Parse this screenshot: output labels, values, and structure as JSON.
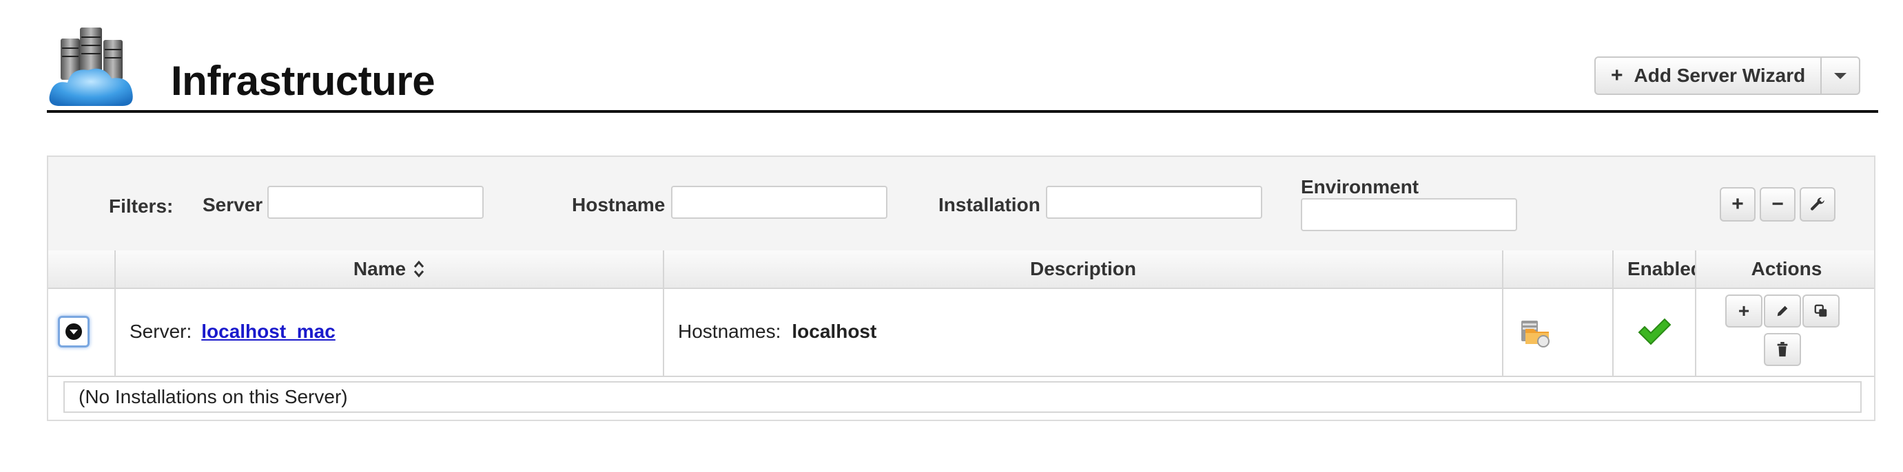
{
  "header": {
    "title": "Infrastructure",
    "logo_icon": "server-cloud-icon",
    "wizard_plus": "+",
    "wizard_label": "Add Server Wizard",
    "wizard_caret_icon": "caret-down-icon"
  },
  "filters": {
    "label": "Filters:",
    "server_label": "Server",
    "server_value": "",
    "hostname_label": "Hostname",
    "hostname_value": "",
    "installation_label": "Installation",
    "installation_value": "",
    "environment_label": "Environment",
    "environment_value": "",
    "add_symbol": "+",
    "remove_symbol": "−",
    "wrench_icon": "wrench-icon"
  },
  "table": {
    "columns": {
      "name": "Name",
      "description": "Description",
      "enabled": "Enabled",
      "actions": "Actions"
    },
    "sort_icon": "sort-icon",
    "rows": [
      {
        "name_prefix": "Server:",
        "name_link": "localhost_mac",
        "desc_prefix": "Hostnames:",
        "desc_value": "localhost",
        "type_icon": "server-folder-icon",
        "enabled_icon": "checkmark-icon",
        "action_add": "+",
        "action_edit_icon": "pencil-icon",
        "action_copy_icon": "copy-icon",
        "action_delete_icon": "trash-icon",
        "subrow_text": "(No Installations on this Server)"
      }
    ]
  },
  "colors": {
    "link": "#1a1acc",
    "check": "#3cb521",
    "cloud": "#4aa8e8"
  }
}
